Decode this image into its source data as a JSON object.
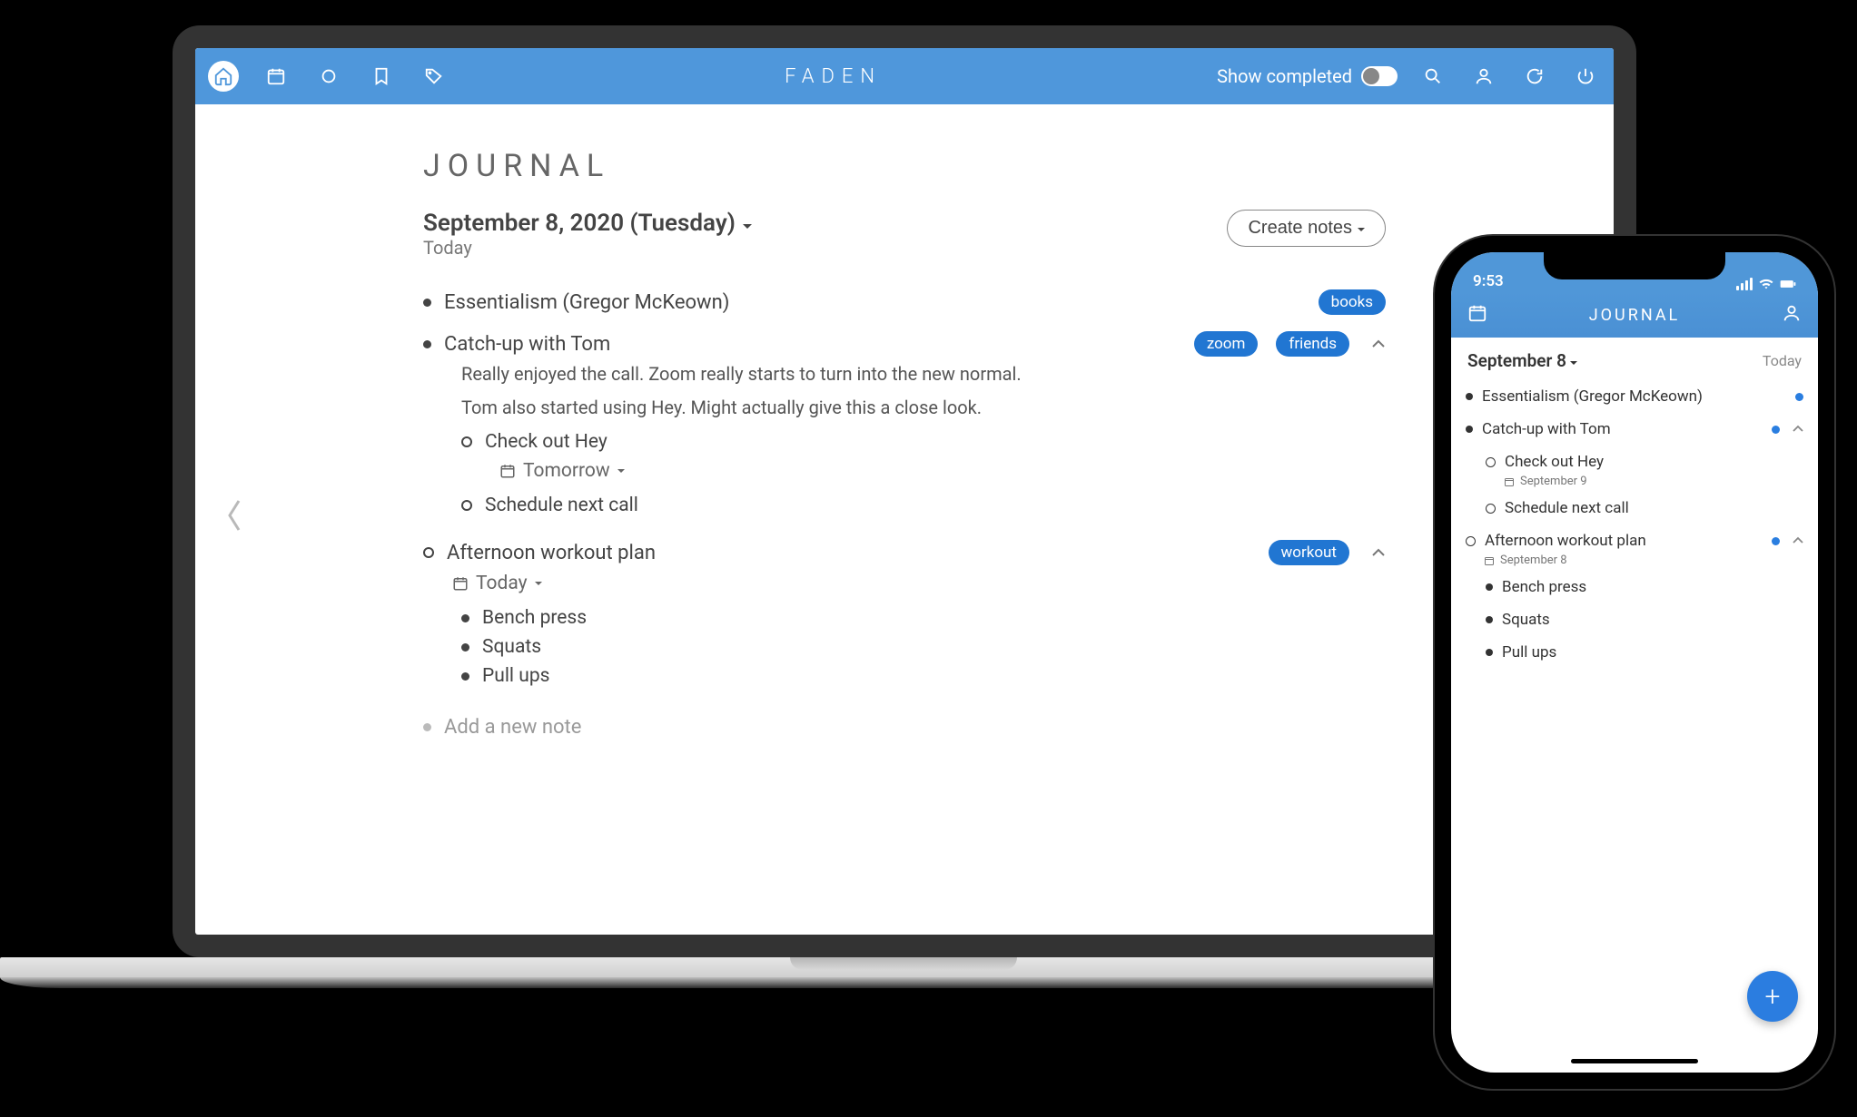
{
  "header": {
    "title": "FADEN",
    "show_completed_label": "Show completed"
  },
  "page": {
    "title": "JOURNAL",
    "date_heading": "September 8, 2020 (Tuesday)",
    "today_label": "Today",
    "create_notes_label": "Create notes"
  },
  "entries": [
    {
      "type": "note",
      "title": "Essentialism (Gregor McKeown)",
      "tags": [
        "books"
      ]
    },
    {
      "type": "note",
      "title": "Catch-up with Tom",
      "tags": [
        "zoom",
        "friends"
      ],
      "collapsible": true,
      "body": [
        "Really enjoyed the call. Zoom really starts to turn into the new normal.",
        "Tom also started using Hey. Might actually give this a close look."
      ],
      "children": [
        {
          "type": "task",
          "title": "Check out Hey",
          "scheduled": "Tomorrow"
        },
        {
          "type": "task",
          "title": "Schedule next call"
        }
      ]
    },
    {
      "type": "task",
      "title": "Afternoon workout plan",
      "tags": [
        "workout"
      ],
      "collapsible": true,
      "scheduled": "Today",
      "children": [
        {
          "type": "note",
          "title": "Bench press"
        },
        {
          "type": "note",
          "title": "Squats"
        },
        {
          "type": "note",
          "title": "Pull ups"
        }
      ]
    }
  ],
  "add_note_placeholder": "Add a new note",
  "phone": {
    "status_time": "9:53",
    "header_title": "JOURNAL",
    "date_heading": "September 8",
    "today_label": "Today",
    "entries": [
      {
        "type": "note",
        "title": "Essentialism (Gregor McKeown)",
        "has_tag": true
      },
      {
        "type": "note",
        "title": "Catch-up with Tom",
        "has_tag": true,
        "collapsible": true,
        "children": [
          {
            "type": "task",
            "title": "Check out Hey",
            "scheduled": "September 9"
          },
          {
            "type": "task",
            "title": "Schedule next call"
          }
        ]
      },
      {
        "type": "task",
        "title": "Afternoon workout plan",
        "has_tag": true,
        "collapsible": true,
        "scheduled": "September 8",
        "children": [
          {
            "type": "note",
            "title": "Bench press"
          },
          {
            "type": "note",
            "title": "Squats"
          },
          {
            "type": "note",
            "title": "Pull ups"
          }
        ]
      }
    ]
  }
}
